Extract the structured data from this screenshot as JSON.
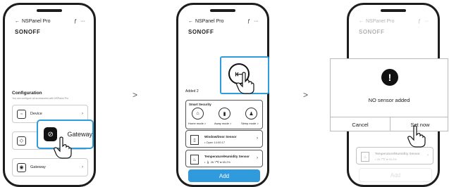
{
  "phone1": {
    "title": "NSPanel Pro",
    "menu_glyphs": [
      "ƒ",
      "···"
    ],
    "brand": "SONOFF",
    "section_title": "Configuration",
    "section_desc": "You can configure all accessories with NSPanel Pro",
    "rows": [
      {
        "label": "Device"
      },
      {
        "label": ""
      },
      {
        "label": "Gateway"
      }
    ],
    "highlight_label": "Gateway"
  },
  "phone2": {
    "title": "NSPanel Pro",
    "menu_glyphs": [
      "ƒ",
      "···"
    ],
    "brand": "SONOFF",
    "added_label": "Added 2",
    "security_label": "Smart Security",
    "modes": [
      {
        "label": "Home mode >",
        "icon": "home-icon"
      },
      {
        "label": "Away mode >",
        "icon": "door-icon"
      },
      {
        "label": "Sleep mode >",
        "icon": "person-icon"
      }
    ],
    "devices": [
      {
        "name": "Window/Door Sensor",
        "status": "• Open 14:00:17"
      },
      {
        "name": "Temperature/Humidity Sensor",
        "status": "• 🌡 26.7℃ ● 65.2%"
      }
    ],
    "add_label": "Add"
  },
  "phone3": {
    "title": "NSPanel Pro",
    "menu_glyphs": [
      "ƒ",
      "···"
    ],
    "brand": "SONOFF",
    "device_name": "Temperature/Humidity Sensor",
    "device_status": "• 26.7℃ ● 65.2%",
    "add_label": "Add",
    "dialog": {
      "icon": "!",
      "message": "NO sensor added",
      "cancel": "Cancel",
      "confirm": "Set now"
    }
  },
  "arrows": [
    ">",
    ">"
  ],
  "colors": {
    "accent": "#2f9bdc",
    "frame": "#1d1d1d"
  }
}
